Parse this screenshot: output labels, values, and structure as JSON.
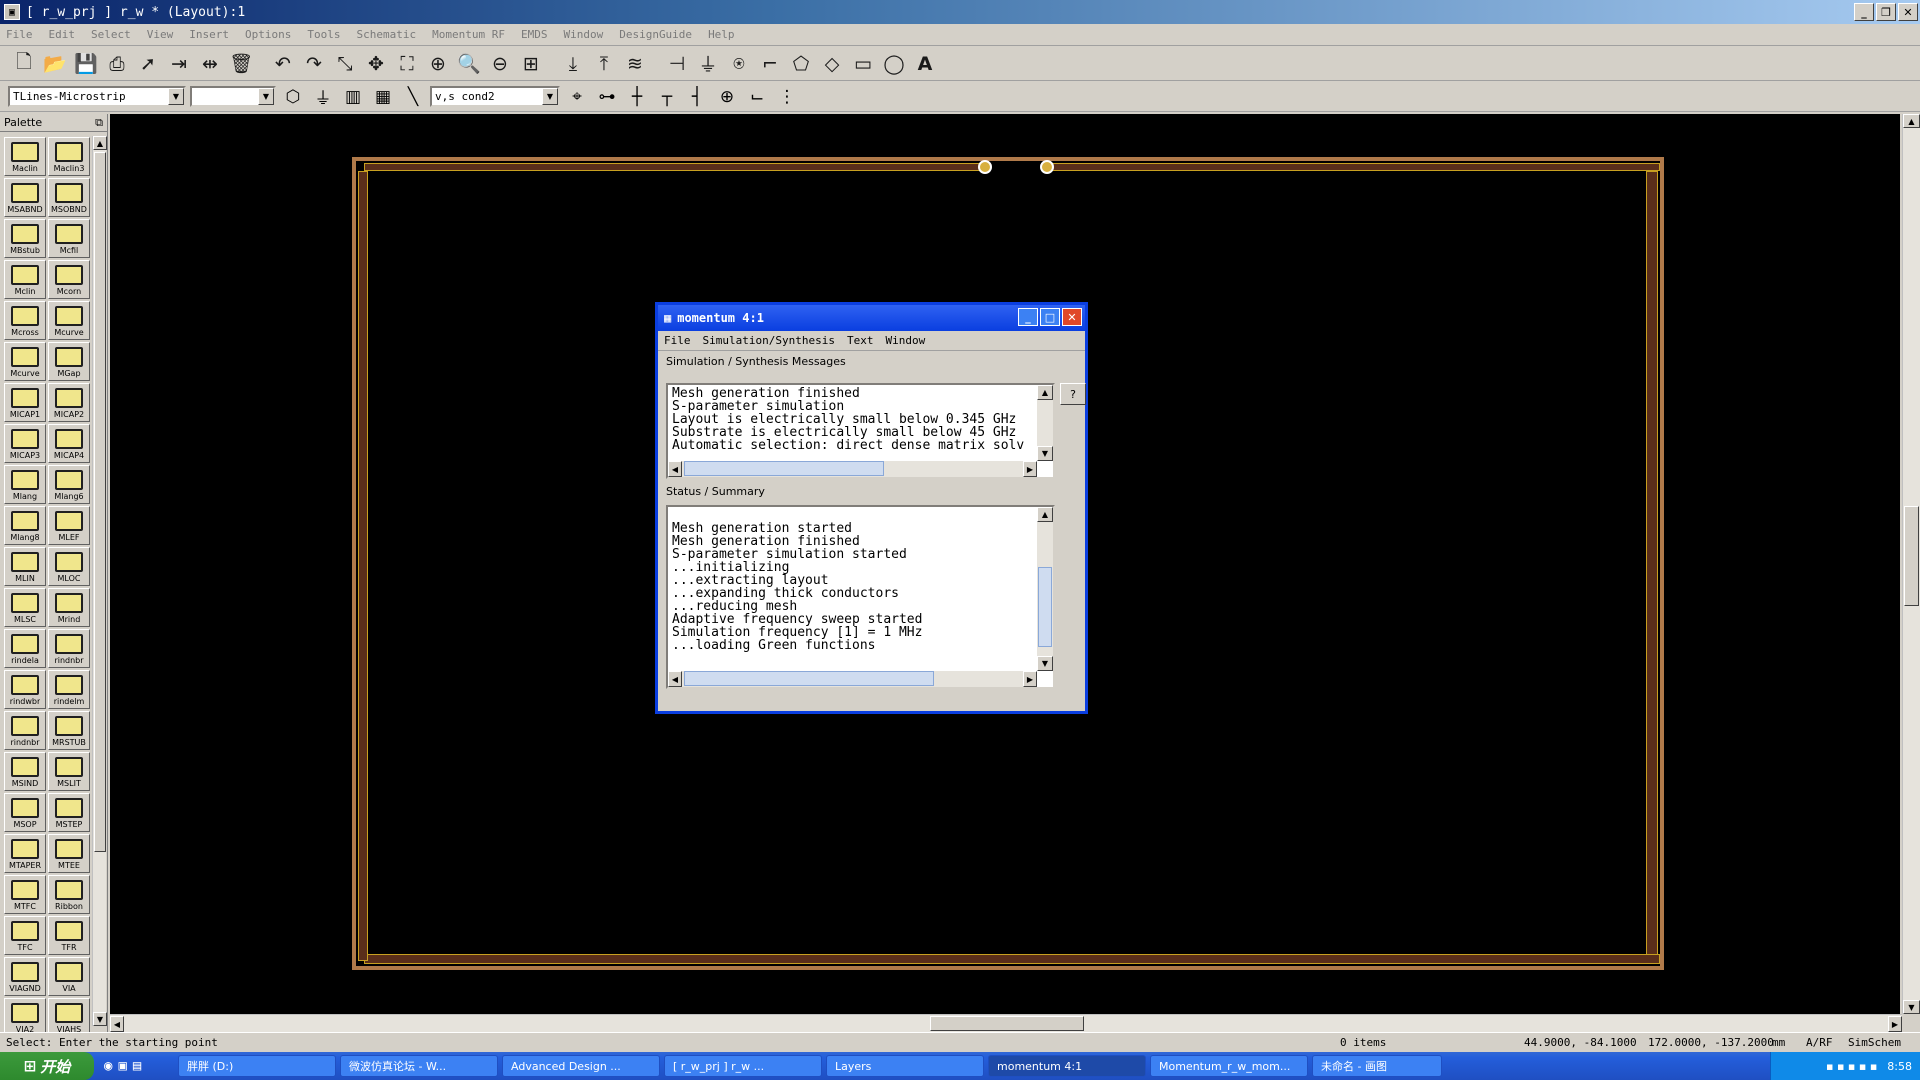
{
  "window": {
    "title": "[ r_w_prj ] r_w * (Layout):1",
    "icon": "ads-app-icon"
  },
  "menubar": [
    "File",
    "Edit",
    "Select",
    "View",
    "Insert",
    "Options",
    "Tools",
    "Schematic",
    "Momentum RF",
    "EMDS",
    "Window",
    "DesignGuide",
    "Help"
  ],
  "toolbar2": {
    "library_combo": "TLines-Microstrip",
    "component_combo": "",
    "layer_combo": "v,s cond2"
  },
  "palette": {
    "title": "Palette",
    "items": [
      "Maclin",
      "Maclin3",
      "MSABND",
      "MSOBND",
      "MBstub",
      "Mcfil",
      "Mclin",
      "Mcorn",
      "Mcross",
      "Mcurve",
      "Mcurve",
      "MGap",
      "MICAP1",
      "MICAP2",
      "MICAP3",
      "MICAP4",
      "Mlang",
      "Mlang6",
      "Mlang8",
      "MLEF",
      "MLIN",
      "MLOC",
      "MLSC",
      "Mrind",
      "rindela",
      "rindnbr",
      "rindwbr",
      "rindelm",
      "rindnbr",
      "MRSTUB",
      "MSIND",
      "MSLIT",
      "MSOP",
      "MSTEP",
      "MTAPER",
      "MTEE",
      "MTFC",
      "Ribbon",
      "TFC",
      "TFR",
      "VIAGND",
      "VIA",
      "VIA2",
      "VIAHS"
    ]
  },
  "dialog": {
    "title": "momentum 4:1",
    "menu": [
      "File",
      "Simulation/Synthesis",
      "Text",
      "Window"
    ],
    "messages_label": "Simulation / Synthesis Messages",
    "help_button": "?",
    "messages": [
      "Mesh generation finished",
      "S-parameter simulation",
      "Layout is electrically small below 0.345 GHz",
      "Substrate is electrically small below 45 GHz",
      "Automatic selection: direct dense matrix solv"
    ],
    "status_label": "Status / Summary",
    "status": [
      "",
      "Mesh generation started",
      "Mesh generation finished",
      "S-parameter simulation started",
      "...initializing",
      "...extracting layout",
      "...expanding thick conductors",
      "...reducing mesh",
      "Adaptive frequency sweep started",
      "Simulation frequency [1] = 1 MHz",
      "...loading Green functions"
    ]
  },
  "statusbar": {
    "prompt": "Select: Enter the starting point",
    "items": "0 items",
    "coords": "44.9000, -84.1000",
    "coords2": "172.0000, -137.2000",
    "units": "mm",
    "mode": "A/RF",
    "sim": "SimSchem"
  },
  "taskbar": {
    "start": "开始",
    "tasks": [
      "胖胖 (D:)",
      "微波仿真论坛 - W...",
      "Advanced Design ...",
      "[ r_w_prj ] r_w ...",
      "Layers",
      "momentum 4:1",
      "Momentum_r_w_mom...",
      "未命名 - 画图"
    ],
    "clock": "8:58"
  }
}
